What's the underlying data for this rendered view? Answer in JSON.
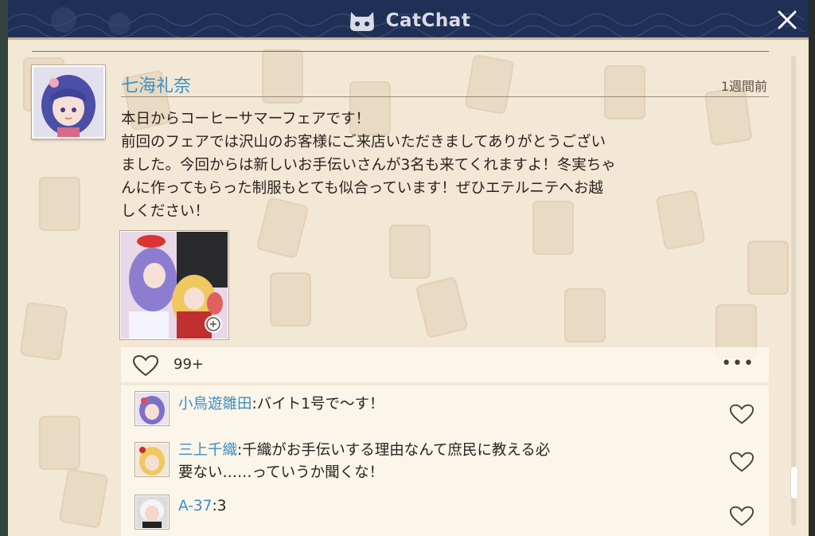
{
  "app": {
    "title": "CatChat"
  },
  "post": {
    "author": "七海礼奈",
    "time": "1週間前",
    "body": "本日からコーヒーサマーフェアです！\n前回のフェアでは沢山のお客様にご来店いただきましてありがとうござい\nました。今回からは新しいお手伝いさんが3名も来てくれますよ！冬実ちゃ\nんに作ってもらった制服もとても似合っています！ぜひエテルニテへお越\nしください！",
    "like_count": "99+"
  },
  "comments": [
    {
      "name": "小鳥遊雛田",
      "separator": ":",
      "text": "バイト1号で～す！"
    },
    {
      "name": "三上千織",
      "separator": ":",
      "text": "千織がお手伝いする理由なんて庶民に教える必\n要ない……っていうか聞くな！"
    },
    {
      "name": "A-37",
      "separator": ":",
      "text": "3"
    }
  ],
  "scroll": {
    "position": 0.88
  },
  "colors": {
    "titlebar": "#1f2f55",
    "panel": "#f3e7d6",
    "name_blue": "#3d8fc0"
  },
  "icons": [
    "cat-logo-icon",
    "close-icon",
    "heart-icon",
    "more-icon",
    "video-play-icon"
  ]
}
